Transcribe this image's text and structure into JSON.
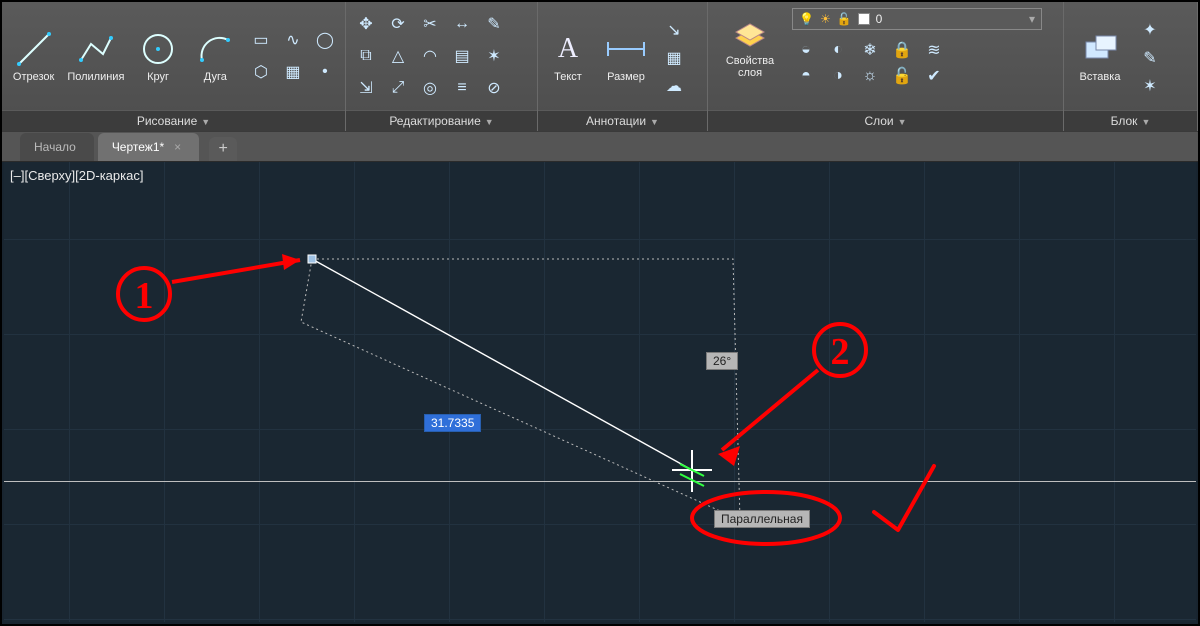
{
  "ribbon": {
    "draw": {
      "title": "Рисование",
      "tools": {
        "line": "Отрезок",
        "polyline": "Полилиния",
        "circle": "Круг",
        "arc": "Дуга"
      }
    },
    "edit": {
      "title": "Редактирование"
    },
    "anno": {
      "title": "Аннотации",
      "tools": {
        "text": "Текст",
        "dim": "Размер"
      }
    },
    "layers": {
      "title": "Слои",
      "props": "Свойства\nслоя",
      "current": "0"
    },
    "block": {
      "title": "Блок",
      "insert": "Вставка"
    }
  },
  "tabs": {
    "home": "Начало",
    "drawing": "Чертеж1*"
  },
  "view_label": "[–][Сверху][2D-каркас]",
  "dynamic": {
    "dist": "31.7335",
    "angle": "26°",
    "snap_tip": "Параллельная"
  },
  "annotations": {
    "num1": "1",
    "num2": "2"
  }
}
